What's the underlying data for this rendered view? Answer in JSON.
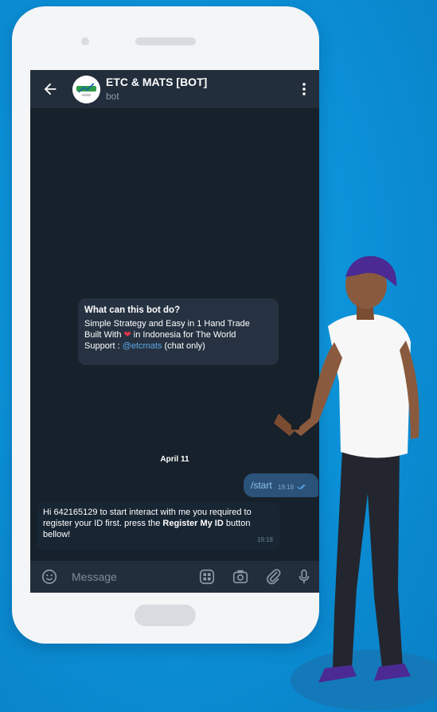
{
  "chat": {
    "title": "ETC & MATS [BOT]",
    "subtitle": "bot",
    "avatar_label": "OneTrade"
  },
  "info_card": {
    "heading": "What can this bot do?",
    "line1": "Simple Strategy and Easy in 1 Hand Trade",
    "line2_pre": "Built With ",
    "line2_post": " in Indonesia for The World",
    "line3_pre": "Support : ",
    "support_link": "@etcmats",
    "line3_post": " (chat only)"
  },
  "date_separator": "April 11",
  "outgoing": {
    "text": "/start",
    "time": "19:18"
  },
  "incoming": {
    "text_pre": "Hi 642165129 to start interact with me you required to register your ID first. press the ",
    "text_bold": "Register My ID",
    "text_post": " button bellow!",
    "time": "19:18"
  },
  "input": {
    "placeholder": "Message"
  },
  "icons": [
    "back-arrow-icon",
    "more-vert-icon",
    "emoji-icon",
    "bot-keyboard-icon",
    "camera-icon",
    "attach-icon",
    "mic-icon",
    "double-check-icon",
    "heart-icon"
  ],
  "colors": {
    "background": "#0b8fd6",
    "chat_bg": "#17212b",
    "header": "#232e3c",
    "outgoing_bubble": "#2b5278",
    "link": "#5aa7e6"
  }
}
